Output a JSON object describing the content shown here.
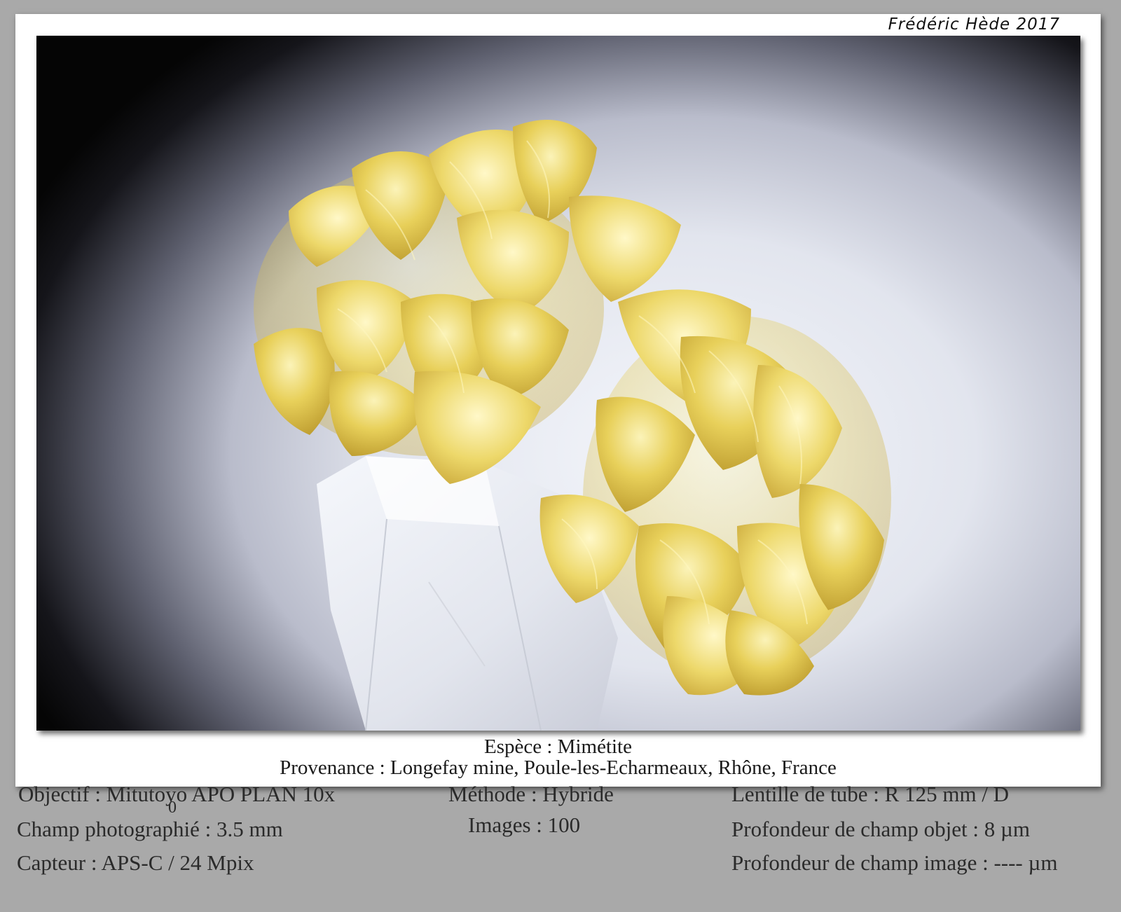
{
  "signature": "Frédéric Hède 2017",
  "caption": {
    "species": "Espèce : Mimétite",
    "origin": "Provenance : Longefay mine, Poule-les-Echarmeaux, Rhône, France"
  },
  "info": {
    "objective": "Objectif : Mitutoyo APO PLAN 10x",
    "objective_sub": "0",
    "field": "Champ photographié : 3.5 mm",
    "sensor": "Capteur : APS-C / 24 Mpix",
    "method": "Méthode : Hybride",
    "images": "Images : 100",
    "tube_lens": "Lentille de tube : R 125 mm / D",
    "dof_object": "Profondeur de champ objet : 8 µm",
    "dof_image": "Profondeur de champ image : ---- µm"
  },
  "colors": {
    "page_background": "#a9a9a9",
    "card": "#ffffff",
    "crystal_yellow": "#e6cf55",
    "quartz": "#e8ebf2",
    "background_dark": "#050505"
  }
}
